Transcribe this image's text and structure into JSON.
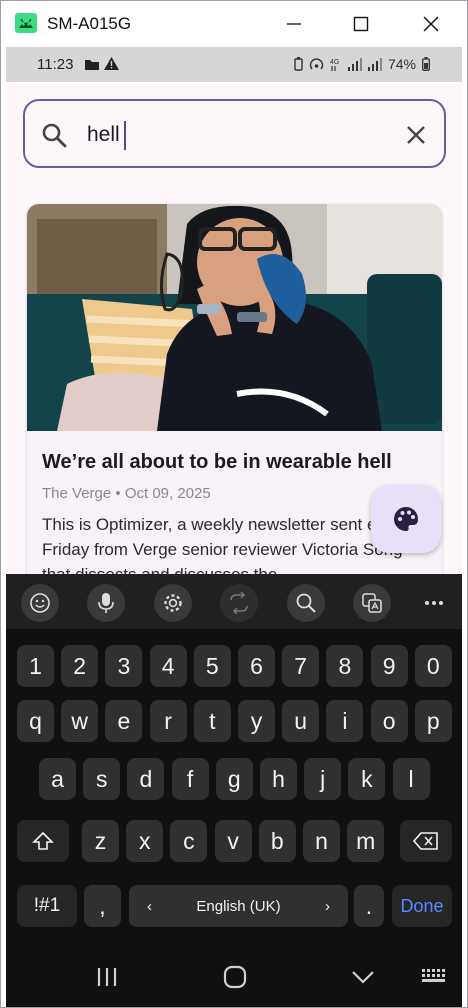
{
  "window": {
    "title": "SM-A015G",
    "accent": "#3ddc84"
  },
  "status_bar": {
    "time": "11:23",
    "battery": "74%"
  },
  "search": {
    "value": "hell",
    "placeholder": ""
  },
  "article": {
    "title": "We’re all about to be in wearable hell",
    "source": "The Verge",
    "separator": "•",
    "date": "Oct 09, 2025",
    "body": "This is Optimizer, a weekly newsletter sent every Friday from Verge senior reviewer Victoria Song that dissects and discusses the"
  },
  "keyboard": {
    "toolbar": [
      "emoji-icon",
      "microphone-icon",
      "settings-icon",
      "translate-icon",
      "search-icon",
      "text-edit-icon",
      "more-icon"
    ],
    "row_numbers": [
      "1",
      "2",
      "3",
      "4",
      "5",
      "6",
      "7",
      "8",
      "9",
      "0"
    ],
    "row_top": [
      "q",
      "w",
      "e",
      "r",
      "t",
      "y",
      "u",
      "i",
      "o",
      "p"
    ],
    "row_middle": [
      "a",
      "s",
      "d",
      "f",
      "g",
      "h",
      "j",
      "k",
      "l"
    ],
    "row_bottom": [
      "z",
      "x",
      "c",
      "v",
      "b",
      "n",
      "m"
    ],
    "symbols_label": "!#1",
    "comma_label": ",",
    "period_label": ".",
    "language_label": "English (UK)",
    "lang_prev": "‹",
    "lang_next": "›",
    "done_label": "Done"
  },
  "colors": {
    "search_border": "#6d5aa5",
    "fab_bg": "#e9e0f8",
    "done": "#4f8cff"
  }
}
